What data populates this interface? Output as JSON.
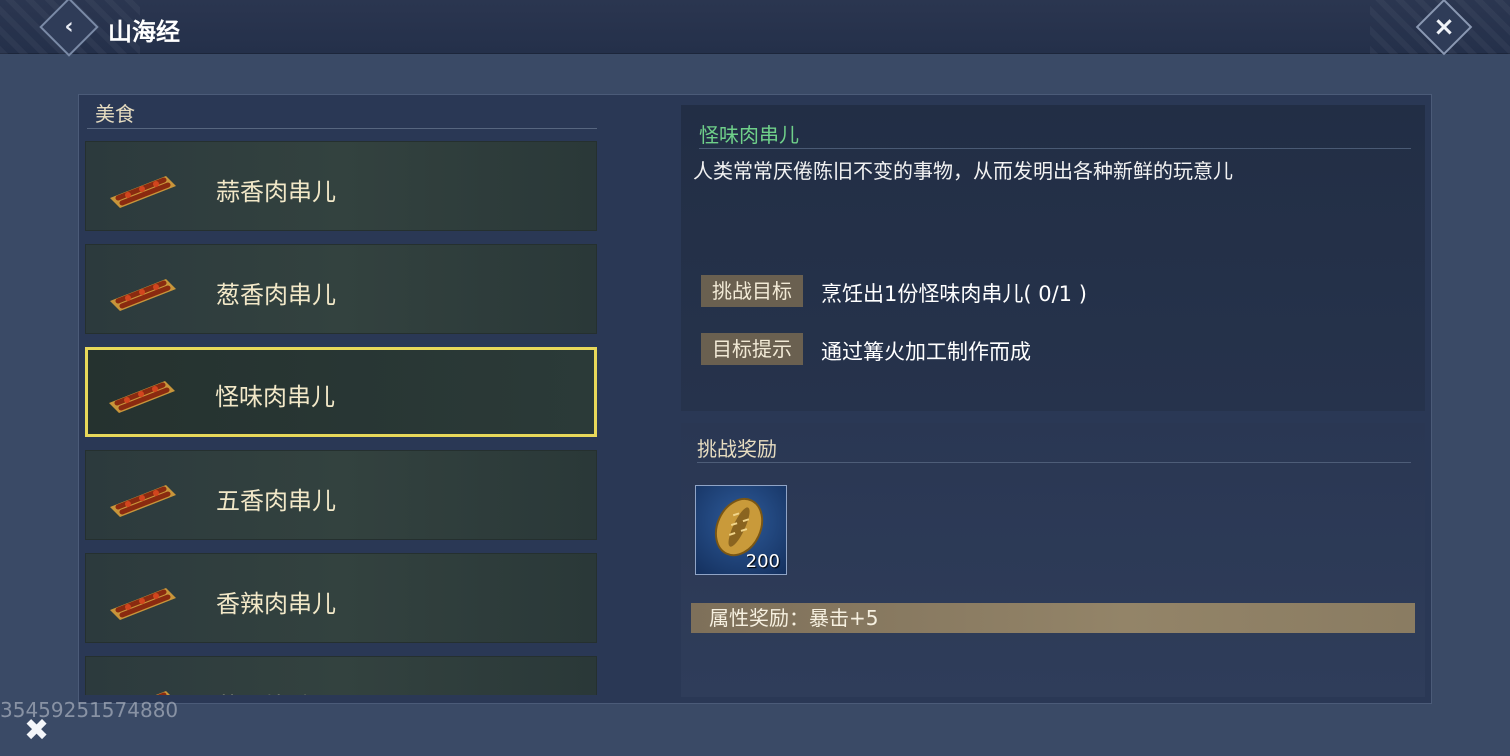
{
  "header": {
    "title": "山海经",
    "back_icon": "back-chevron-icon",
    "close_icon": "close-x-icon"
  },
  "category": {
    "title": "美食",
    "items": [
      {
        "label": "蒜香肉串儿",
        "selected": false
      },
      {
        "label": "葱香肉串儿",
        "selected": false
      },
      {
        "label": "怪味肉串儿",
        "selected": true
      },
      {
        "label": "五香肉串儿",
        "selected": false
      },
      {
        "label": "香辣肉串儿",
        "selected": false
      },
      {
        "label": "蒜香烤鸭",
        "selected": false
      }
    ]
  },
  "detail": {
    "title": "怪味肉串儿",
    "description": "人类常常厌倦陈旧不变的事物，从而发明出各种新鲜的玩意儿",
    "goal_tag": "挑战目标",
    "goal_text": "烹饪出1份怪味肉串儿( 0/1 )",
    "hint_tag": "目标提示",
    "hint_text": "通过篝火加工制作而成"
  },
  "reward": {
    "title": "挑战奖励",
    "item_icon": "golden-shell-coin-icon",
    "item_count": "200",
    "attribute": "属性奖励：暴击+5"
  },
  "footer": {
    "watermark": "35459251574880",
    "x_icon": "crossed-swords-icon"
  },
  "colors": {
    "selected_border": "#e8d85a",
    "detail_title": "#6fd08a"
  }
}
